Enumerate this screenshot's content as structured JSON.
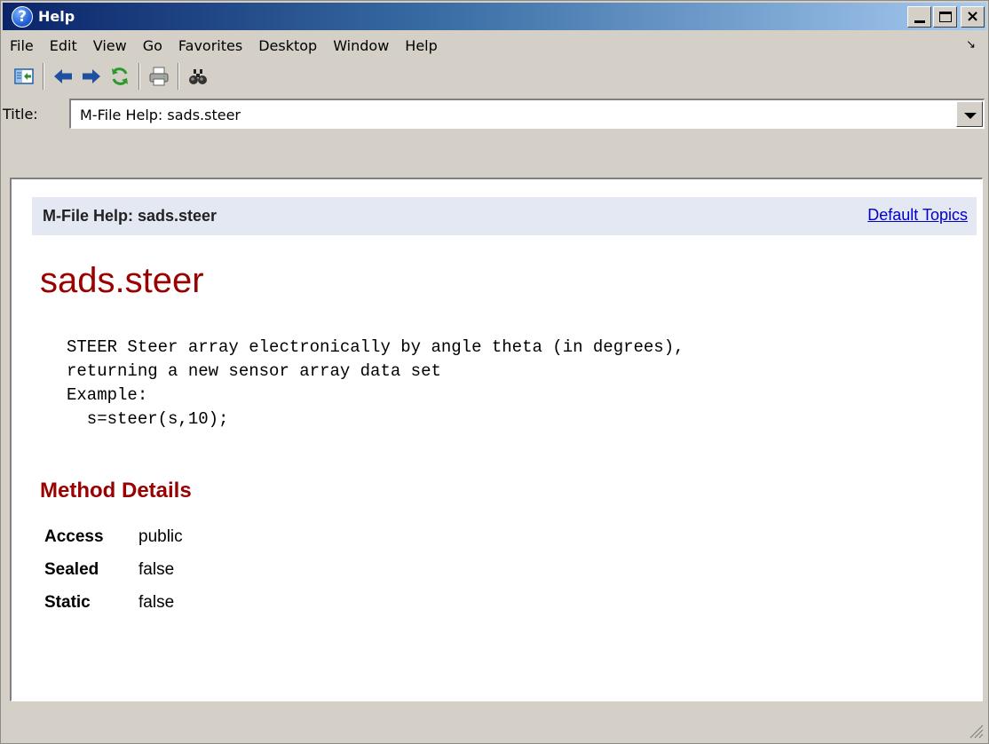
{
  "window": {
    "title": "Help",
    "title_icon_glyph": "?",
    "buttons": {
      "minimize": "minimize-button",
      "maximize": "maximize-button",
      "close": "close-button"
    }
  },
  "menu": {
    "items": [
      "File",
      "Edit",
      "View",
      "Go",
      "Favorites",
      "Desktop",
      "Window",
      "Help"
    ]
  },
  "toolbar": {
    "icons": [
      "hide-navigator-icon",
      "back-arrow-icon",
      "forward-arrow-icon",
      "refresh-icon",
      "print-icon",
      "find-binoculars-icon"
    ]
  },
  "titlebar_field": {
    "label": "Title:",
    "value": "M-File Help: sads.steer"
  },
  "content": {
    "header_title": "M-File Help: sads.steer",
    "header_link": "Default Topics",
    "heading": "sads.steer",
    "code": "STEER Steer array electronically by angle theta (in degrees),\nreturning a new sensor array data set\nExample:\n  s=steer(s,10);",
    "section_heading": "Method Details",
    "details": [
      {
        "key": "Access",
        "value": "public"
      },
      {
        "key": "Sealed",
        "value": "false"
      },
      {
        "key": "Static",
        "value": "false"
      }
    ]
  },
  "colors": {
    "title_bar_start": "#0a246a",
    "title_bar_end": "#a6caf0",
    "heading": "#990000",
    "link": "#0000cc",
    "header_band": "#e4e8f2"
  }
}
